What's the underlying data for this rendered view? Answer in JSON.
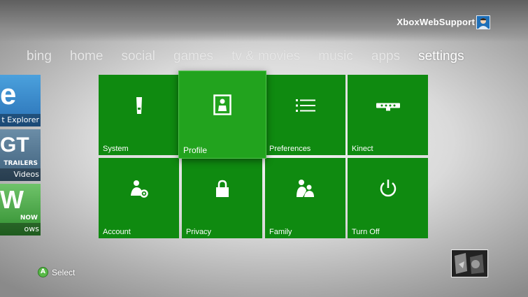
{
  "header": {
    "gamertag": "XboxWebSupport",
    "avatar_icon": "avatar-icon"
  },
  "nav": {
    "items": [
      "bing",
      "home",
      "social",
      "games",
      "tv & movies",
      "music",
      "apps",
      "settings"
    ],
    "active": "settings"
  },
  "side_tiles": [
    {
      "label": "t Explorer",
      "glyph": "e"
    },
    {
      "label": "Videos",
      "glyph": "GT",
      "sub": "TRAILERS"
    },
    {
      "label": "ows",
      "glyph": "W",
      "sub": "NOW"
    }
  ],
  "tiles": {
    "system": "System",
    "profile": "Profile",
    "preferences": "Preferences",
    "kinect": "Kinect",
    "account": "Account",
    "privacy": "Privacy",
    "family": "Family",
    "turn_off": "Turn Off"
  },
  "footer": {
    "button_letter": "A",
    "select_label": "Select"
  },
  "colors": {
    "tile_green": "#0f8a10",
    "selected_green": "#22a31e",
    "a_button": "#58b947"
  }
}
